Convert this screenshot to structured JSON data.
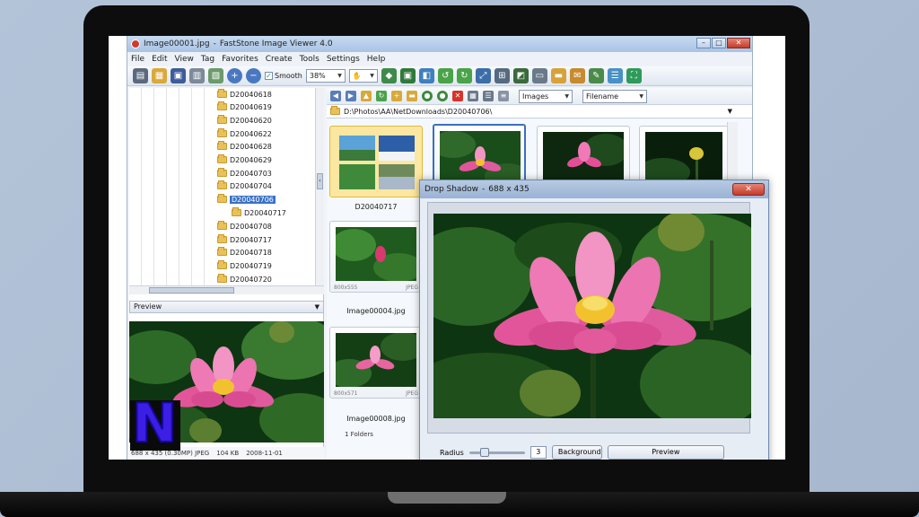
{
  "app": {
    "title_file": "Image00001.jpg",
    "title_app": "FastStone Image Viewer 4.0",
    "title_sep": "-"
  },
  "window_controls": {
    "minimize": "–",
    "maximize": "□",
    "close": "✕"
  },
  "menu": [
    "File",
    "Edit",
    "View",
    "Tag",
    "Favorites",
    "Create",
    "Tools",
    "Settings",
    "Help"
  ],
  "toolbar": {
    "smooth_label": "Smooth",
    "smooth_checked": "✓",
    "zoom_value": "38%",
    "filter_value": "Images",
    "sort_value": "Filename",
    "arrow": "▼"
  },
  "tree": {
    "items": [
      {
        "label": "D20040618"
      },
      {
        "label": "D20040619"
      },
      {
        "label": "D20040620"
      },
      {
        "label": "D20040622"
      },
      {
        "label": "D20040628"
      },
      {
        "label": "D20040629"
      },
      {
        "label": "D20040703"
      },
      {
        "label": "D20040704"
      },
      {
        "label": "D20040706",
        "selected": true
      },
      {
        "label": "D20040717",
        "child": true
      },
      {
        "label": "D20040708"
      },
      {
        "label": "D20040717"
      },
      {
        "label": "D20040718"
      },
      {
        "label": "D20040719"
      },
      {
        "label": "D20040720"
      }
    ]
  },
  "preview": {
    "label": "Preview",
    "arrow": "▼"
  },
  "status": {
    "dimensions": "688 x 435 (0.30MP) JPEG",
    "size": "104 KB",
    "date": "2008-11-01"
  },
  "path": {
    "value": "D:\\Photos\\AA\\NetDownloads\\D20040706\\",
    "arrow": "▼"
  },
  "thumbnails": {
    "folder_label": "D20040717",
    "items": [
      {
        "label": "Image00004.jpg",
        "dims": "800x555",
        "type": "JPEG"
      },
      {
        "label": "Image00008.jpg",
        "dims": "800x571",
        "type": "JPEG"
      }
    ],
    "folders_count": "1 Folders"
  },
  "dialog": {
    "title": "Drop Shadow",
    "title_sep": "-",
    "size": "688 x 435",
    "close": "✕",
    "radius_label": "Radius",
    "radius_value": "3",
    "background_label": "Background",
    "preview_label": "Preview"
  },
  "logo": {
    "letter": "N",
    "color": "#3d1ee5"
  },
  "colors": {
    "accent": "#3a72c6",
    "title_bar": "#a9c3e3",
    "close": "#c43b2a",
    "bezel": "#0d0d0d"
  }
}
